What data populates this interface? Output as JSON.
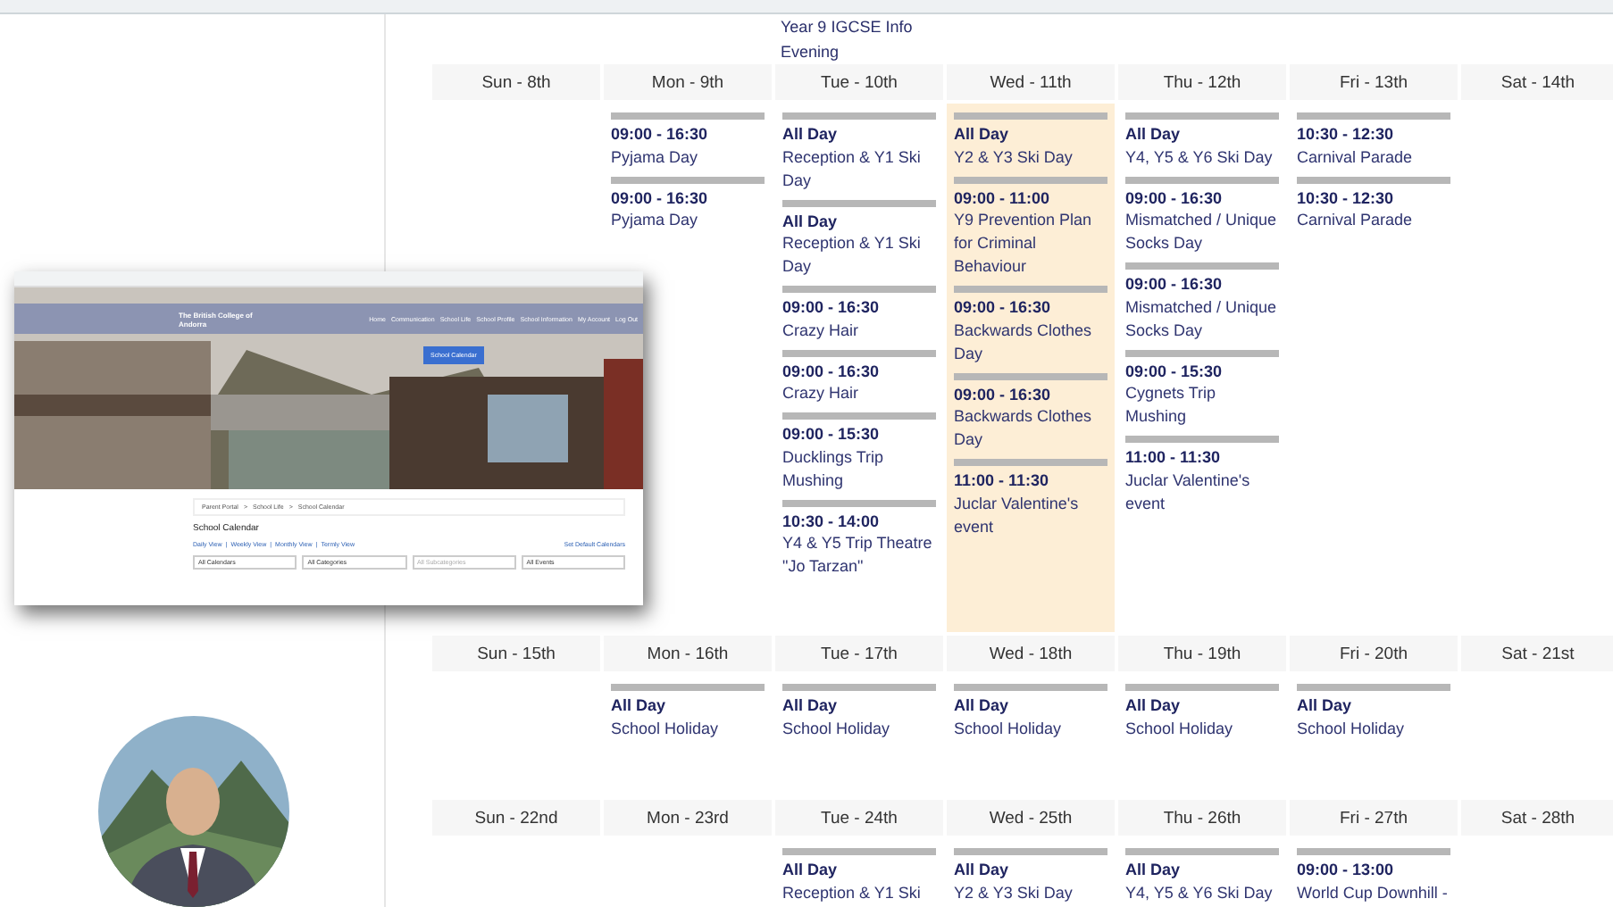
{
  "top_event": {
    "title": "Year 9 IGCSE Info",
    "title_end": "Evening"
  },
  "inset": {
    "brand": "The British College of Andorra",
    "nav": [
      "Home",
      "Communication",
      "School Life",
      "School Profile",
      "School Information",
      "My Account",
      "Log Out"
    ],
    "cta": "School Calendar",
    "breadcrumb": [
      "Parent Portal",
      ">",
      "School Life",
      ">",
      "School Calendar"
    ],
    "heading": "School Calendar",
    "views": [
      "Daily View",
      "|",
      "Weekly View",
      "|",
      "Monthly View",
      "|",
      "Termly View"
    ],
    "default_link": "Set Default Calendars",
    "filters": [
      {
        "label": "All Calendars",
        "disabled": false
      },
      {
        "label": "All Categories",
        "disabled": false
      },
      {
        "label": "All Subcategories",
        "disabled": true
      },
      {
        "label": "All Events",
        "disabled": false
      }
    ]
  },
  "weeks": [
    {
      "days": [
        {
          "label": "Sun - 8th",
          "today": false
        },
        {
          "label": "Mon - 9th",
          "today": false,
          "events": [
            {
              "time": "09:00 - 16:30",
              "title": "Pyjama Day"
            },
            {
              "time": "09:00 - 16:30",
              "title": "Pyjama Day"
            }
          ]
        },
        {
          "label": "Tue - 10th",
          "today": false,
          "events": [
            {
              "time": "All Day",
              "title": "Reception & Y1 Ski Day"
            },
            {
              "time": "All Day",
              "title": "Reception & Y1 Ski Day"
            },
            {
              "time": "09:00 - 16:30",
              "title": "Crazy Hair"
            },
            {
              "time": "09:00 - 16:30",
              "title": "Crazy Hair"
            },
            {
              "time": "09:00 - 15:30",
              "title": "Ducklings Trip Mushing"
            },
            {
              "time": "10:30 - 14:00",
              "title": "Y4 & Y5 Trip Theatre \"Jo Tarzan\""
            }
          ]
        },
        {
          "label": "Wed - 11th",
          "today": true,
          "events": [
            {
              "time": "All Day",
              "title": "Y2 & Y3 Ski Day"
            },
            {
              "time": "09:00 - 11:00",
              "title": "Y9 Prevention Plan for Criminal Behaviour"
            },
            {
              "time": "09:00 - 16:30",
              "title": "Backwards Clothes Day"
            },
            {
              "time": "09:00 - 16:30",
              "title": "Backwards Clothes Day"
            },
            {
              "time": "11:00 - 11:30",
              "title": "Juclar Valentine's event"
            }
          ]
        },
        {
          "label": "Thu - 12th",
          "today": false,
          "events": [
            {
              "time": "All Day",
              "title": "Y4, Y5 & Y6 Ski Day"
            },
            {
              "time": "09:00 - 16:30",
              "title": "Mismatched / Unique Socks Day"
            },
            {
              "time": "09:00 - 16:30",
              "title": "Mismatched / Unique Socks Day"
            },
            {
              "time": "09:00 - 15:30",
              "title": "Cygnets Trip Mushing"
            },
            {
              "time": "11:00 - 11:30",
              "title": "Juclar Valentine's event"
            }
          ]
        },
        {
          "label": "Fri - 13th",
          "today": false,
          "events": [
            {
              "time": "10:30 - 12:30",
              "title": "Carnival Parade"
            },
            {
              "time": "10:30 - 12:30",
              "title": "Carnival Parade"
            }
          ]
        },
        {
          "label": "Sat - 14th",
          "today": false
        }
      ]
    },
    {
      "days": [
        {
          "label": "Sun - 15th",
          "today": false
        },
        {
          "label": "Mon - 16th",
          "today": false,
          "events": [
            {
              "time": "All Day",
              "title": "School Holiday"
            }
          ]
        },
        {
          "label": "Tue - 17th",
          "today": false,
          "events": [
            {
              "time": "All Day",
              "title": "School Holiday"
            }
          ]
        },
        {
          "label": "Wed - 18th",
          "today": false,
          "events": [
            {
              "time": "All Day",
              "title": "School Holiday"
            }
          ]
        },
        {
          "label": "Thu - 19th",
          "today": false,
          "events": [
            {
              "time": "All Day",
              "title": "School Holiday"
            }
          ]
        },
        {
          "label": "Fri - 20th",
          "today": false,
          "events": [
            {
              "time": "All Day",
              "title": "School Holiday"
            }
          ]
        },
        {
          "label": "Sat - 21st",
          "today": false
        }
      ]
    },
    {
      "days": [
        {
          "label": "Sun - 22nd",
          "today": false
        },
        {
          "label": "Mon - 23rd",
          "today": false
        },
        {
          "label": "Tue - 24th",
          "today": false,
          "events": [
            {
              "time": "All Day",
              "title": "Reception & Y1 Ski"
            }
          ]
        },
        {
          "label": "Wed - 25th",
          "today": false,
          "events": [
            {
              "time": "All Day",
              "title": "Y2 & Y3 Ski Day"
            }
          ]
        },
        {
          "label": "Thu - 26th",
          "today": false,
          "events": [
            {
              "time": "All Day",
              "title": "Y4, Y5 & Y6 Ski Day"
            }
          ]
        },
        {
          "label": "Fri - 27th",
          "today": false,
          "events": [
            {
              "time": "09:00 - 13:00",
              "title": "World Cup Downhill -"
            }
          ]
        },
        {
          "label": "Sat - 28th",
          "today": false
        }
      ]
    }
  ]
}
